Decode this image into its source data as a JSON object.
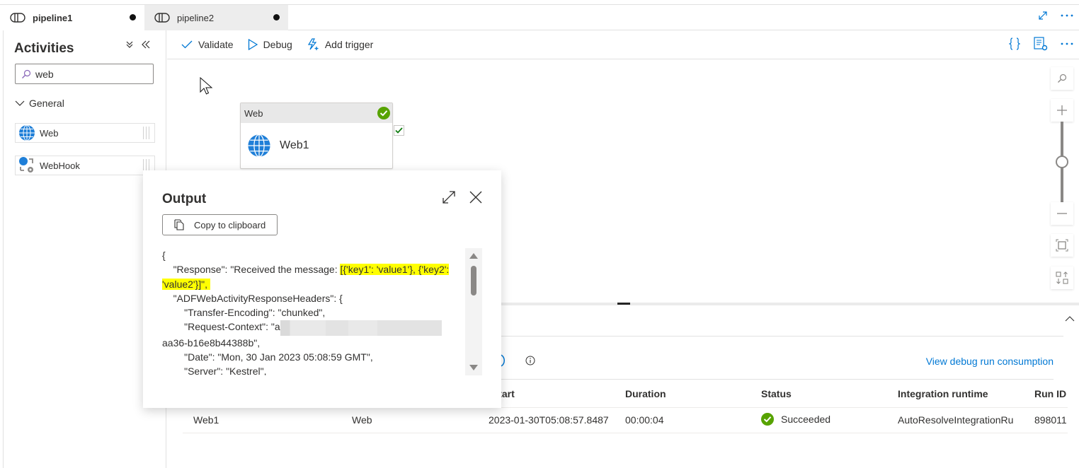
{
  "tabs": [
    {
      "label": "pipeline1",
      "active": true,
      "unsaved": true,
      "icon": "pipeline-icon"
    },
    {
      "label": "pipeline2",
      "active": false,
      "unsaved": true,
      "icon": "pipeline-icon"
    }
  ],
  "tab_actions": [
    "expand-icon",
    "more-icon"
  ],
  "activities": {
    "title": "Activities",
    "search": {
      "value": "web",
      "placeholder": ""
    },
    "group": "General",
    "items": [
      {
        "label": "Web",
        "icon": "globe-icon"
      },
      {
        "label": "WebHook",
        "icon": "webhook-icon"
      }
    ]
  },
  "toolbar": {
    "validate": "Validate",
    "debug": "Debug",
    "add_trigger": "Add trigger",
    "right_icons": [
      "code-braces-icon",
      "properties-icon",
      "more-icon"
    ]
  },
  "canvas": {
    "node": {
      "type": "Web",
      "name": "Web1",
      "status": "succeeded"
    },
    "zoom_controls": [
      "search",
      "zoom-in",
      "zoom-slider",
      "zoom-out",
      "fit-to-screen",
      "auto-align"
    ],
    "zoom_level": 0.5
  },
  "output_popup": {
    "title": "Output",
    "copy_label": "Copy to clipboard",
    "lines": {
      "l0": "{",
      "l1a": "    \"Response\": \"Received the message: ",
      "l1b": "[{'key1': 'value1'}, {'key2':",
      "l2": "'value2'}]\", ",
      "l3": "    \"ADFWebActivityResponseHeaders\": {",
      "l4": "        \"Transfer-Encoding\": \"chunked\",",
      "l5a": "        \"Request-Context\": \"a",
      "l6": "aa36-b16e8b44388b\",",
      "l7": "        \"Date\": \"Mon, 30 Jan 2023 05:08:59 GMT\",",
      "l8": "        \"Server\": \"Kestrel\","
    }
  },
  "bottom": {
    "consumption_link": "View debug run consumption",
    "columns": [
      "n start",
      "Duration",
      "Status",
      "Integration runtime",
      "Run ID"
    ],
    "rows": [
      {
        "name": "Web1",
        "type": "Web",
        "run_start": "2023-01-30T05:08:57.8487",
        "duration": "00:00:04",
        "status": "Succeeded",
        "runtime": "AutoResolveIntegrationRu",
        "run_id": "898011"
      }
    ]
  },
  "colors": {
    "accent": "#0078d4",
    "success": "#57a300",
    "highlight": "#ffff00"
  }
}
